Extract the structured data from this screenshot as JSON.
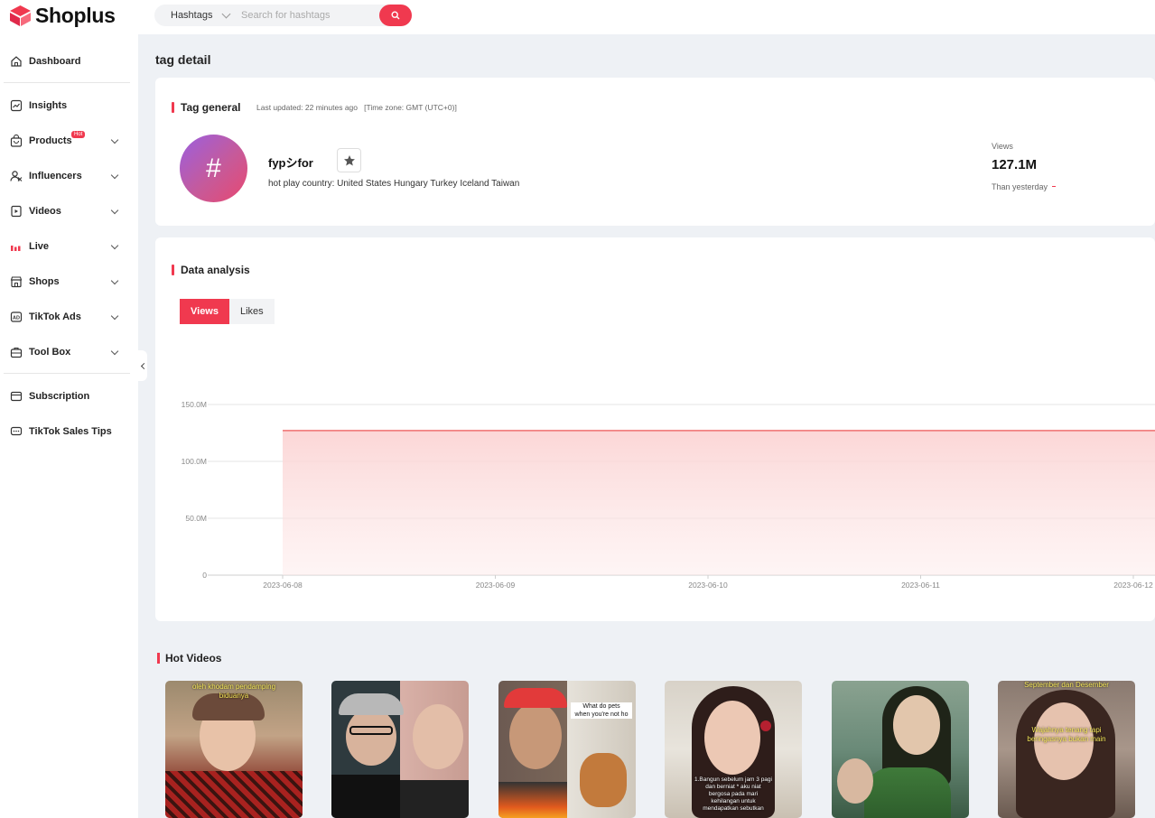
{
  "app": {
    "name": "Shoplus"
  },
  "search": {
    "type_label": "Hashtags",
    "placeholder": "Search for hashtags"
  },
  "sidebar": {
    "items": [
      {
        "label": "Dashboard",
        "icon": "home-icon",
        "has_arrow": false
      },
      {
        "label": "Insights",
        "icon": "chart-icon",
        "has_arrow": false
      },
      {
        "label": "Products",
        "icon": "bag-icon",
        "has_arrow": true,
        "badge": "Hot"
      },
      {
        "label": "Influencers",
        "icon": "users-icon",
        "has_arrow": true
      },
      {
        "label": "Videos",
        "icon": "video-icon",
        "has_arrow": true
      },
      {
        "label": "Live",
        "icon": "live-icon",
        "has_arrow": true
      },
      {
        "label": "Shops",
        "icon": "shop-icon",
        "has_arrow": true
      },
      {
        "label": "TikTok Ads",
        "icon": "ads-icon",
        "has_arrow": true
      },
      {
        "label": "Tool Box",
        "icon": "toolbox-icon",
        "has_arrow": true
      },
      {
        "label": "Subscription",
        "icon": "card-icon",
        "has_arrow": false
      },
      {
        "label": "TikTok Sales Tips",
        "icon": "chat-icon",
        "has_arrow": false
      }
    ]
  },
  "page": {
    "title": "tag detail"
  },
  "tag_general": {
    "title": "Tag general",
    "updated": "Last updated: 22 minutes ago   [Time zone: GMT (UTC+0)]",
    "avatar_symbol": "#",
    "name": "fypシfor",
    "hot_country": "hot play country: United States Hungary Turkey Iceland Taiwan",
    "views_label": "Views",
    "views_value": "127.1M",
    "than_yesterday": "Than yesterday"
  },
  "data_analysis": {
    "title": "Data analysis",
    "tabs": [
      "Views",
      "Likes"
    ],
    "active_tab": "Views"
  },
  "chart_data": {
    "type": "area",
    "x": [
      "2023-06-08",
      "2023-06-09",
      "2023-06-10",
      "2023-06-11",
      "2023-06-12"
    ],
    "series": [
      {
        "values": [
          127.1,
          127.1,
          127.1,
          127.1,
          127.1
        ]
      }
    ],
    "yticks": [
      "0",
      "50.0M",
      "100.0M",
      "150.0M"
    ],
    "ylim": [
      0,
      150
    ],
    "grid": true,
    "line_color": "#f07070"
  },
  "hot_videos": {
    "title": "Hot Videos",
    "items": [
      {
        "caption": "oleh khodam pendamping\nbiduanya"
      },
      {
        "caption": ""
      },
      {
        "caption": "What do pets\nwhen you're not ho"
      },
      {
        "caption": "1.Bangun sebelum jam 3 pagi\ndan berniat * aku niat\nbergosa pada mari\nkehilangan untuk\nmendapatkan sebutkan"
      },
      {
        "caption": ""
      },
      {
        "caption": "September dan Desember\n\n\n\n\nWajahnya tenang tapi\nberingasnya bukan main"
      }
    ]
  }
}
